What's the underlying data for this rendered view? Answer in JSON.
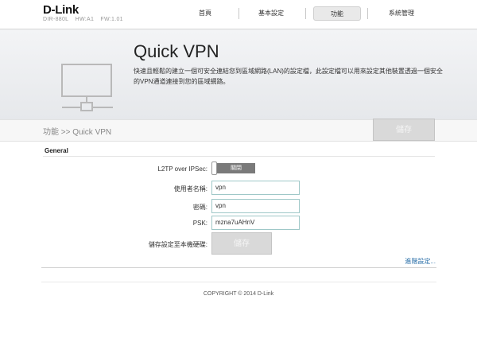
{
  "brand": {
    "logo": "D-Link",
    "model": "DIR-880L",
    "hw": "HW:A1",
    "fw": "FW:1.01"
  },
  "nav": [
    "首頁",
    "基本設定",
    "功能",
    "系統管理"
  ],
  "nav_active": "功能",
  "banner": {
    "title": "Quick VPN",
    "description": "快速且輕鬆的建立一個可安全連結您到區域網路(LAN)的設定檔，此設定檔可以用來設定其他裝置透過一個安全的VPN通道連接到您的區域網路。"
  },
  "breadcrumb": "功能 >> Quick VPN",
  "save_label": "儲存",
  "section": {
    "title": "General"
  },
  "form": {
    "l2tp": {
      "label": "L2TP over IPSec:",
      "state": "關閉"
    },
    "username": {
      "label": "使用者名稱:",
      "value": "vpn"
    },
    "password": {
      "label": "密碼:",
      "value": "vpn"
    },
    "psk": {
      "label": "PSK:",
      "value": "mzna7uAHnV"
    },
    "save_config": {
      "label": "儲存設定至本機硬碟:",
      "button": "儲存"
    }
  },
  "advanced_link": "進階設定...",
  "footer": {
    "copyright": "COPYRIGHT © 2014 D-Link"
  }
}
